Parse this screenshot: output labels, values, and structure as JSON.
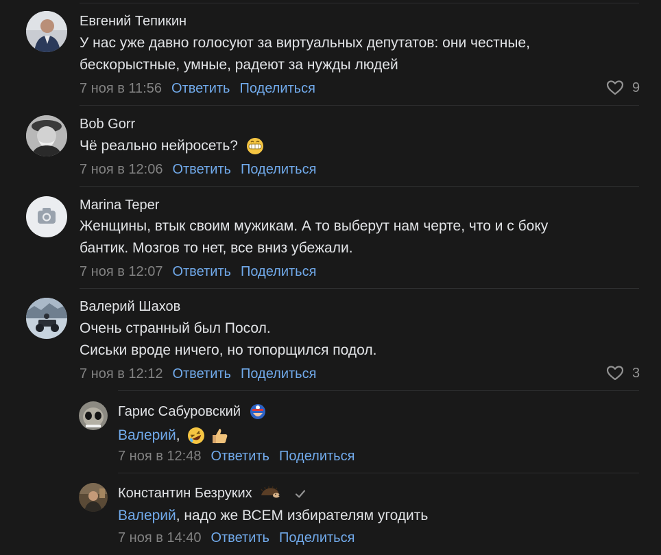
{
  "comments": [
    {
      "author": "Евгений Тепикин",
      "lines": [
        "У нас уже давно голосуют за виртуальных депутатов: они честные,",
        "бескорыстные, умные, радеют за нужды людей"
      ],
      "date": "7 ноя в 11:56",
      "reply": "Ответить",
      "share": "Поделиться",
      "likes": "9"
    },
    {
      "author": "Bob Gorr",
      "text": "Чё реально нейросеть?",
      "date": "7 ноя в 12:06",
      "reply": "Ответить",
      "share": "Поделиться"
    },
    {
      "author": "Marina Teper",
      "lines": [
        "Женщины, втык своим мужикам. А то выберут нам черте, что и с боку",
        "бантик. Мозгов то нет, все вниз убежали."
      ],
      "date": "7 ноя в 12:07",
      "reply": "Ответить",
      "share": "Поделиться"
    },
    {
      "author": "Валерий Шахов",
      "lines": [
        "Очень странный был Посол.",
        "Сиськи вроде ничего, но топорщился подол."
      ],
      "date": "7 ноя в 12:12",
      "reply": "Ответить",
      "share": "Поделиться",
      "likes": "3"
    }
  ],
  "replies": [
    {
      "author": "Гарис Сабуровский",
      "mention": "Валерий",
      "text": ",",
      "date": "7 ноя в 12:48",
      "reply": "Ответить",
      "share": "Поделиться"
    },
    {
      "author": "Константин Безруких",
      "mention": "Валерий",
      "text": ", надо же ВСЕМ избирателям угодить",
      "date": "7 ноя в 14:40",
      "reply": "Ответить",
      "share": "Поделиться"
    }
  ],
  "icons": {
    "like": "heart-icon",
    "camera": "camera-icon",
    "verified": "checkmark-icon"
  },
  "colors": {
    "background": "#191919",
    "link": "#71aaeb",
    "muted": "#828282",
    "text": "#e1e3e6"
  }
}
